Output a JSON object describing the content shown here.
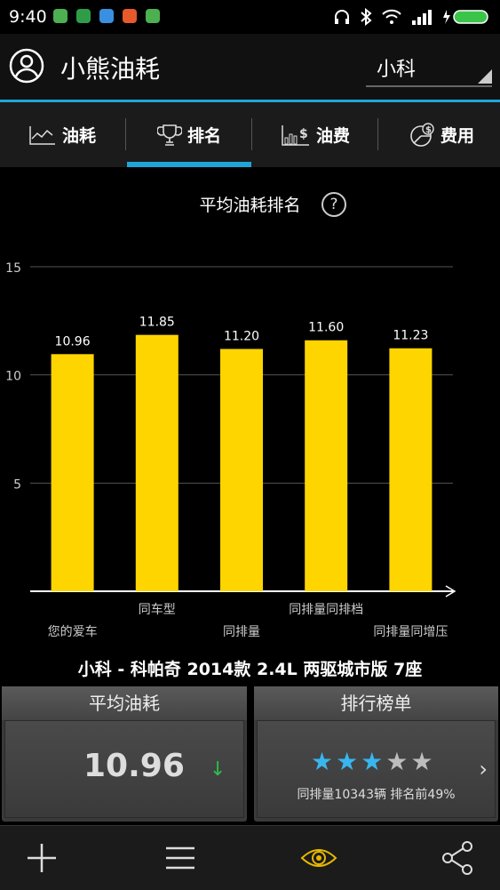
{
  "status": {
    "time": "9:40"
  },
  "app": {
    "title": "小熊油耗",
    "car_selector": "小科"
  },
  "tabs": [
    {
      "label": "油耗",
      "icon": "line-chart-icon"
    },
    {
      "label": "排名",
      "icon": "trophy-icon"
    },
    {
      "label": "油费",
      "icon": "bar-money-icon"
    },
    {
      "label": "费用",
      "icon": "pie-money-icon"
    }
  ],
  "active_tab": 1,
  "chart_section": {
    "title": "平均油耗排名",
    "help_label": "?"
  },
  "chart_data": {
    "type": "bar",
    "categories": [
      "您的爱车",
      "同车型",
      "同排量",
      "同排量同排档",
      "同排量同增压"
    ],
    "values": [
      10.96,
      11.85,
      11.2,
      11.6,
      11.23
    ],
    "value_labels": [
      "10.96",
      "11.85",
      "11.20",
      "11.60",
      "11.23"
    ],
    "ylim": [
      0,
      15
    ],
    "yticks": [
      5,
      10,
      15
    ],
    "grid": true,
    "bar_color": "#ffd500"
  },
  "car_name": "小科 - 科帕奇 2014款 2.4L 两驱城市版 7座",
  "avg_panel": {
    "title": "平均油耗",
    "value": "10.96",
    "trend": "↓"
  },
  "rank_panel": {
    "title": "排行榜单",
    "stars_filled": 3,
    "stars_total": 5,
    "subtitle": "同排量10343辆  排名前49%",
    "chevron": "›"
  },
  "colors": {
    "accent": "#1fa6d8",
    "bar": "#ffd500",
    "trend_down": "#2bbf4a",
    "star_on": "#38b6ef",
    "star_off": "#bdbdbd"
  }
}
